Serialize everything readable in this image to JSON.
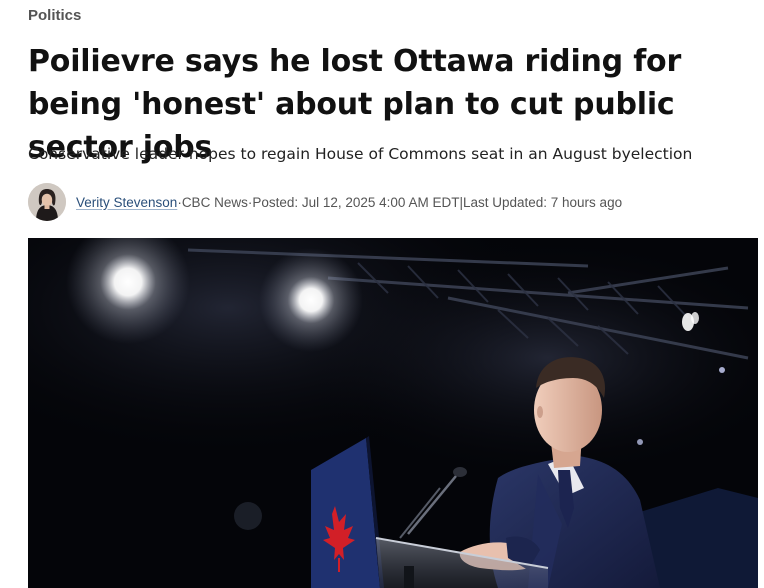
{
  "article": {
    "category": "Politics",
    "headline": "Poilievre says he lost Ottawa riding for being 'honest' about plan to cut public sector jobs",
    "deck": "Conservative leader hopes to regain House of Commons seat in an August byelection",
    "byline": {
      "author": "Verity Stevenson",
      "source_sep": " · ",
      "source": "CBC News",
      "posted_sep": " · ",
      "posted": "Posted: Jul 12, 2025 4:00 AM EDT",
      "updated_sep": " | ",
      "updated": "Last Updated: 7 hours ago"
    },
    "photo": {
      "alt_subject": "person-at-podium-photo"
    }
  }
}
